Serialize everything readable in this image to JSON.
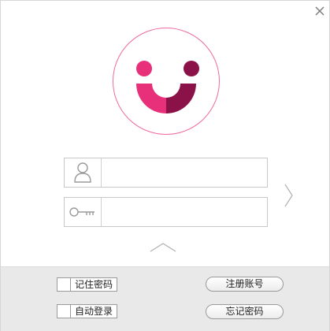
{
  "window": {
    "close_icon": "close-icon",
    "logo_icon": "smiley-logo-icon"
  },
  "login": {
    "username_icon": "user-icon",
    "username_value": "",
    "password_icon": "key-icon",
    "password_value": "",
    "submit_icon": "chevron-right-icon",
    "expand_icon": "chevron-up-icon"
  },
  "options": {
    "remember_password": {
      "label": "记住密码",
      "checked": false
    },
    "auto_login": {
      "label": "自动登录",
      "checked": false
    },
    "register_label": "注册账号",
    "forgot_label": "忘记密码"
  },
  "colors": {
    "accent_pink": "#e8307a",
    "accent_dark": "#8b1248",
    "ring": "#ef6aa0",
    "footer_bg": "#e9e9e9"
  }
}
